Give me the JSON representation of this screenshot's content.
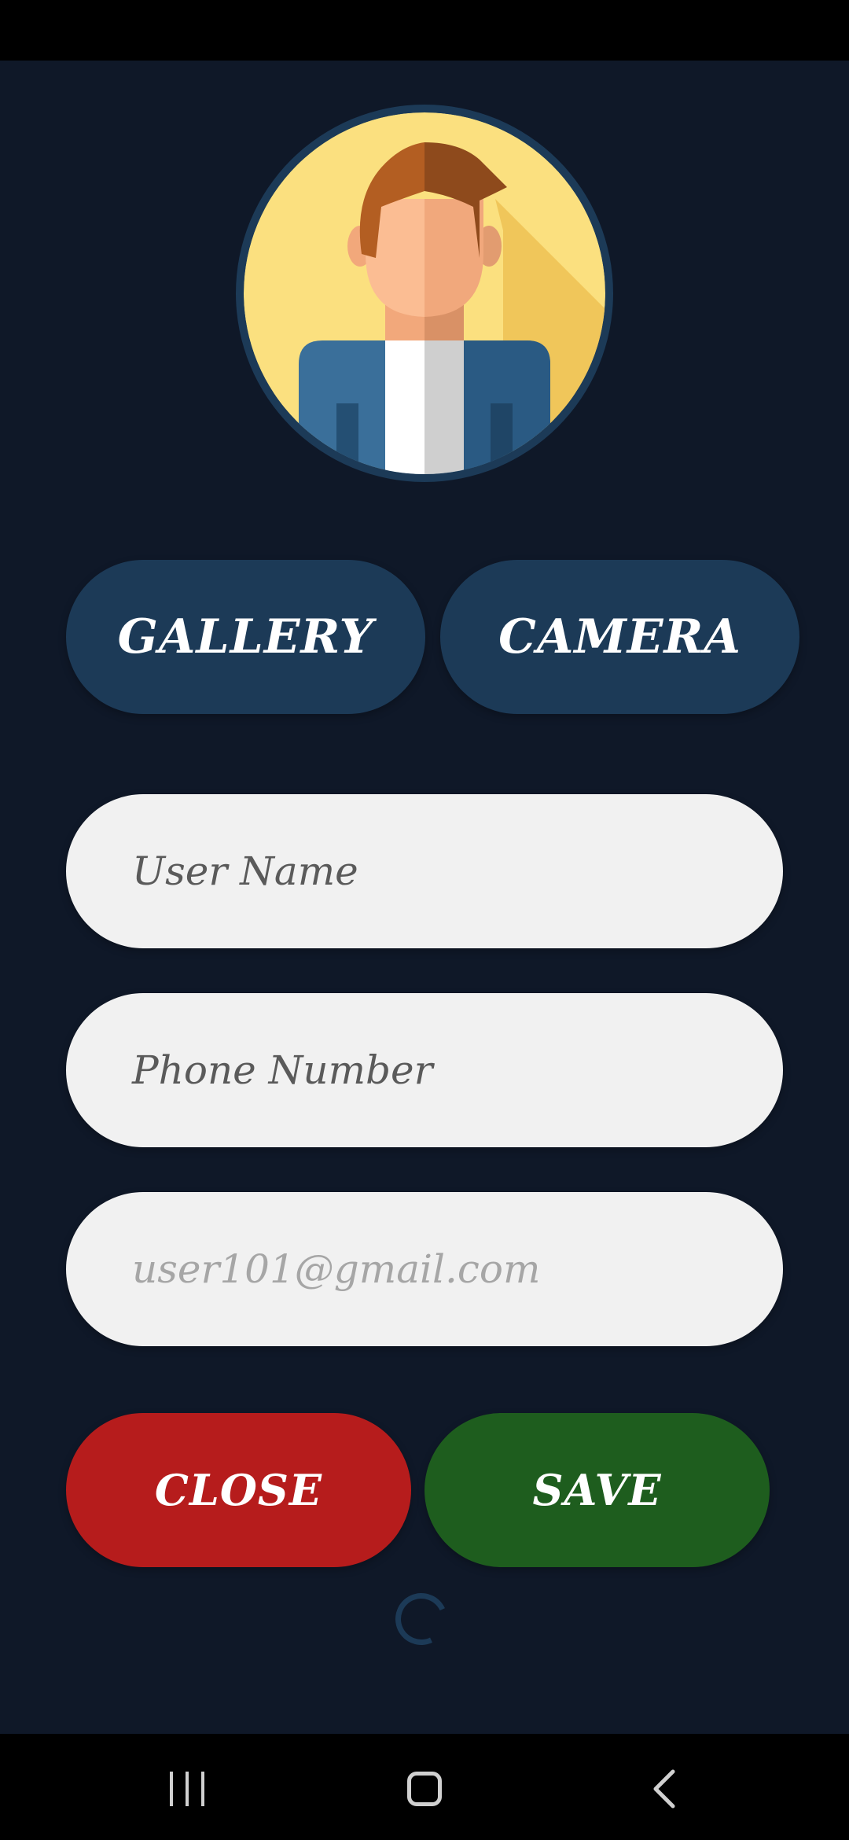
{
  "colors": {
    "background": "#0f1828",
    "accent_button": "#1c3a57",
    "close_button": "#b61c1c",
    "save_button": "#1e5d1e",
    "field_background": "#f1f1f1"
  },
  "avatar": {
    "icon": "person-avatar-icon"
  },
  "media_buttons": {
    "gallery_label": "GALLERY",
    "camera_label": "CAMERA"
  },
  "form": {
    "username": {
      "value": "User Name"
    },
    "phone": {
      "value": "Phone Number"
    },
    "email": {
      "placeholder": "user101@gmail.com"
    }
  },
  "actions": {
    "close_label": "CLOSE",
    "save_label": "SAVE"
  },
  "loading": {
    "icon": "spinner-icon"
  },
  "navigation": {
    "recents_icon": "recents-icon",
    "home_icon": "home-icon",
    "back_icon": "back-icon"
  }
}
